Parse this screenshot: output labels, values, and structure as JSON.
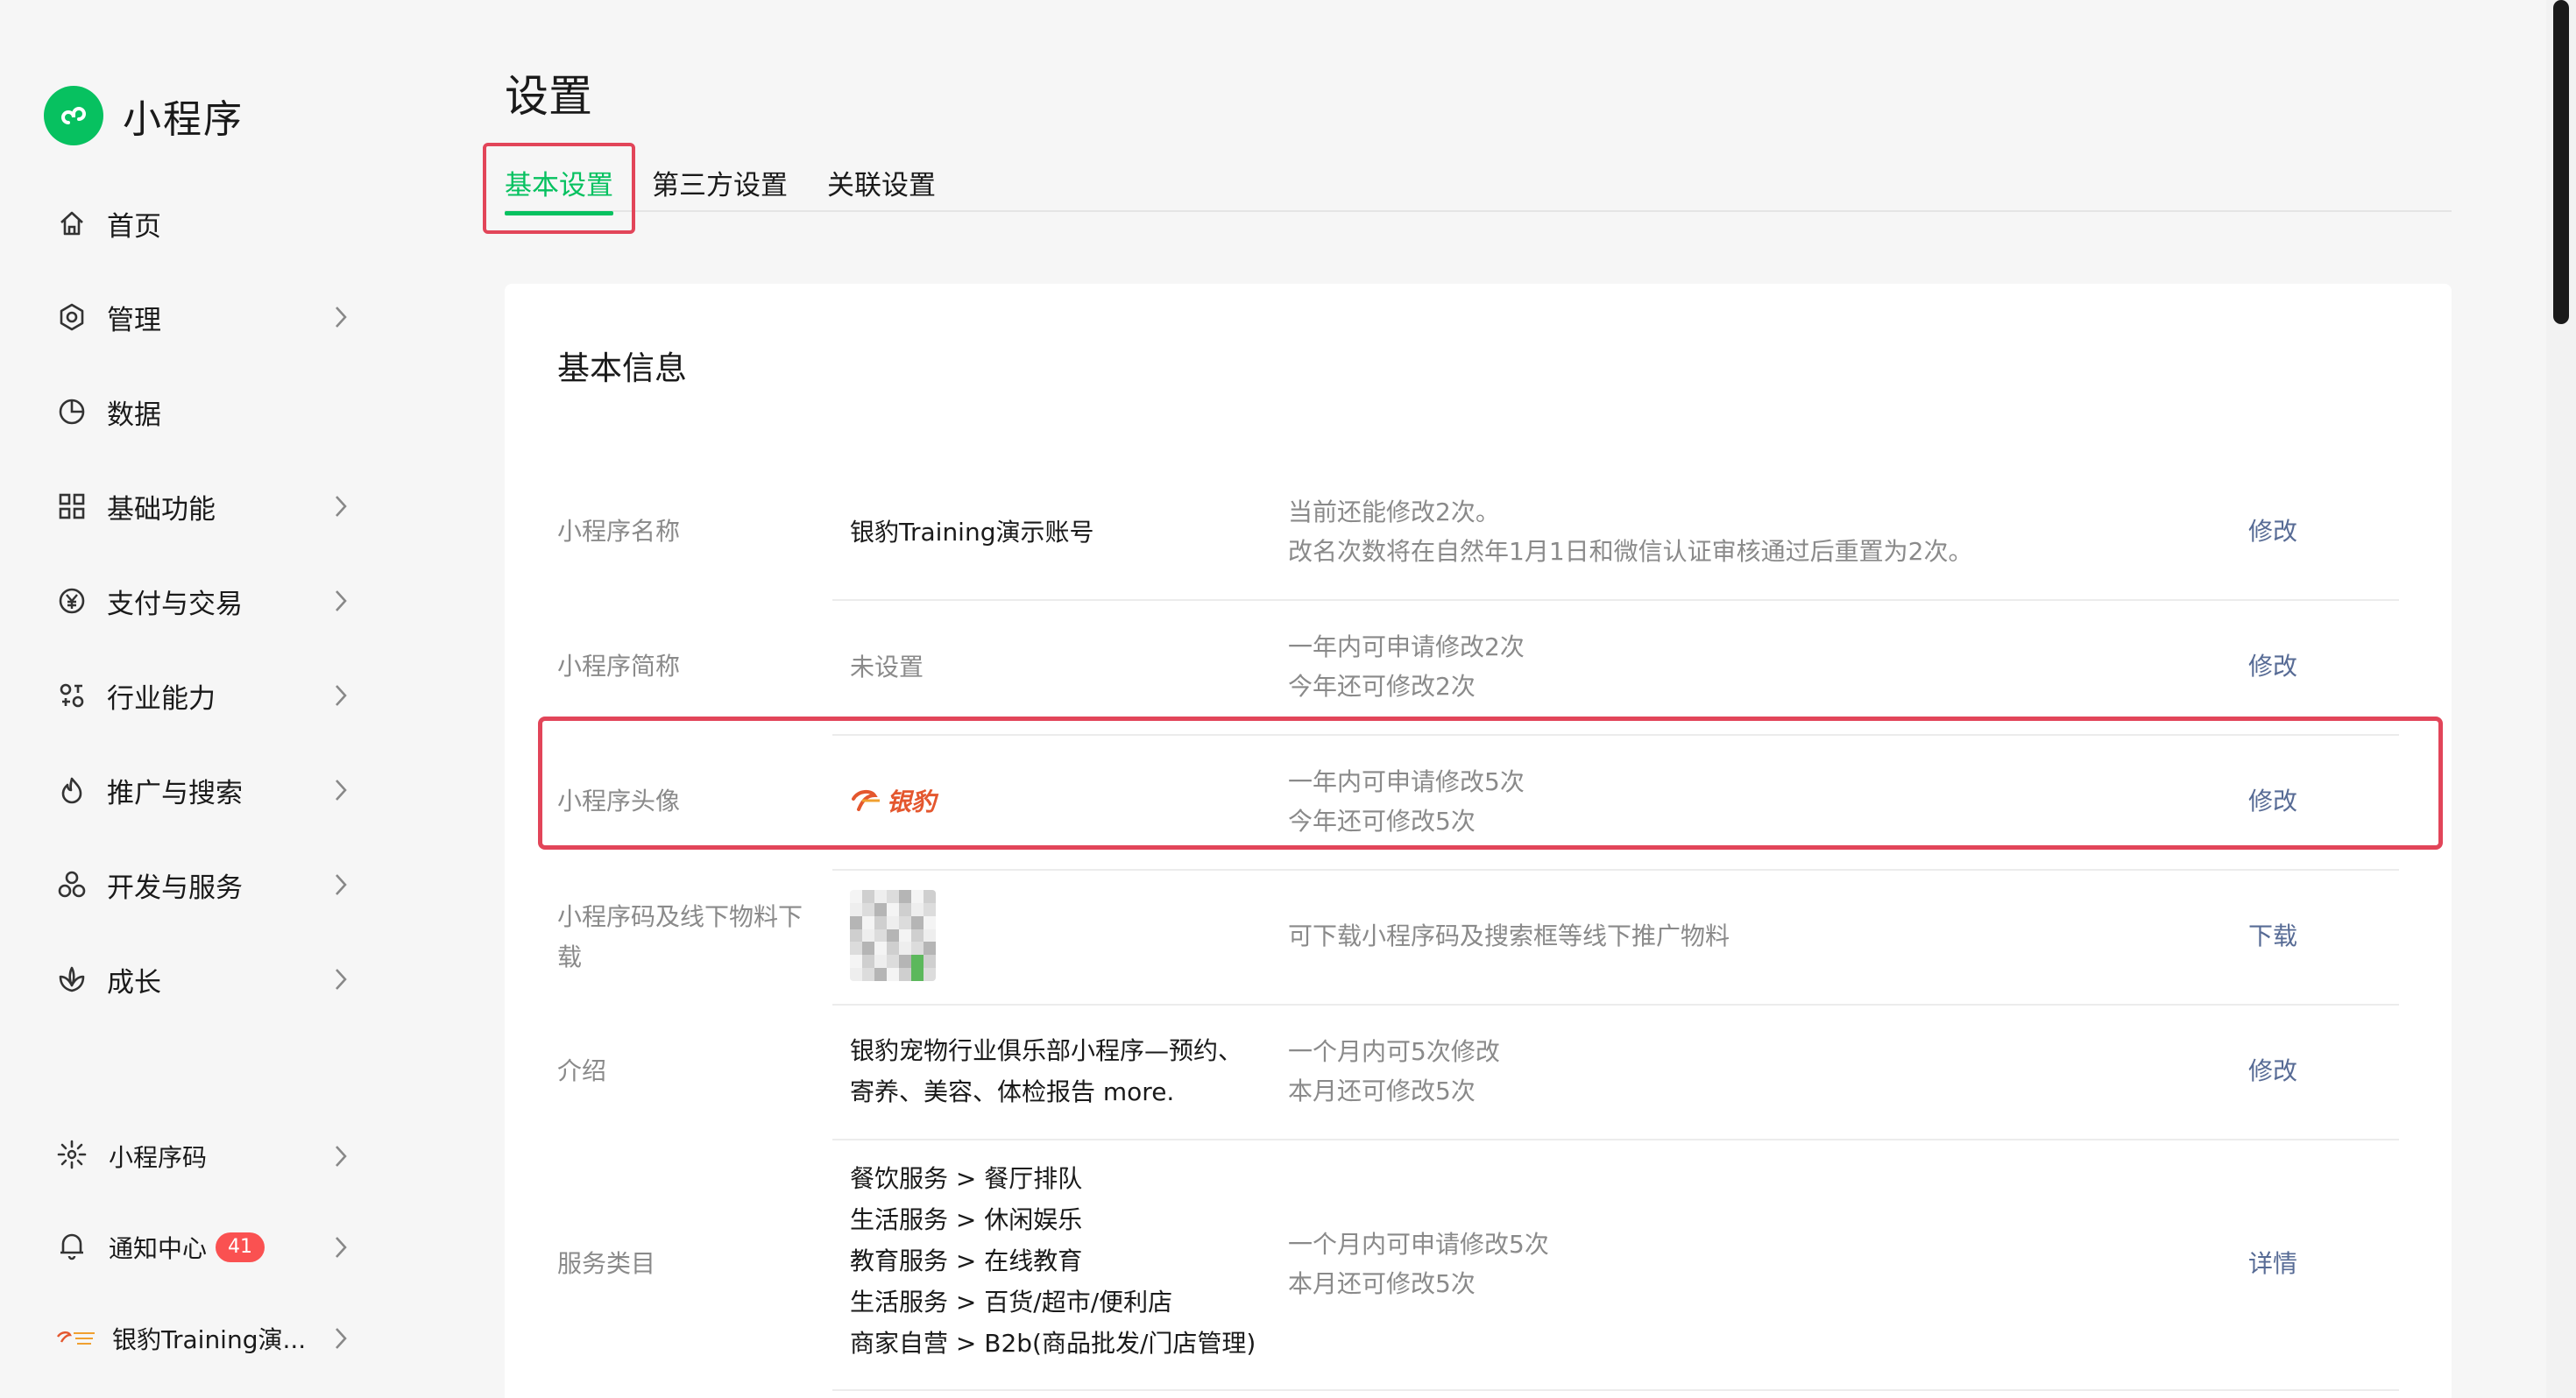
{
  "brand": {
    "name": "小程序",
    "accent": "#07c160"
  },
  "sidebar": {
    "items": [
      {
        "label": "首页",
        "icon": "home-icon",
        "chevron": false
      },
      {
        "label": "管理",
        "icon": "hexagon-settings-icon",
        "chevron": true
      },
      {
        "label": "数据",
        "icon": "pie-chart-icon",
        "chevron": false
      },
      {
        "label": "基础功能",
        "icon": "grid-apps-icon",
        "chevron": true
      },
      {
        "label": "支付与交易",
        "icon": "yen-circle-icon",
        "chevron": true
      },
      {
        "label": "行业能力",
        "icon": "industry-icon",
        "chevron": true
      },
      {
        "label": "推广与搜索",
        "icon": "flame-icon",
        "chevron": true
      },
      {
        "label": "开发与服务",
        "icon": "cluster-icon",
        "chevron": true
      },
      {
        "label": "成长",
        "icon": "lotus-icon",
        "chevron": true
      }
    ],
    "bottom": {
      "qrcode_label": "小程序码",
      "notice_label": "通知中心",
      "notice_count": "41",
      "account_label": "银豹Training演..."
    }
  },
  "page": {
    "title": "设置",
    "tabs": [
      "基本设置",
      "第三方设置",
      "关联设置"
    ],
    "active_tab": 0
  },
  "card": {
    "title": "基本信息",
    "rows": [
      {
        "label": "小程序名称",
        "value": "银豹Training演示账号",
        "desc": [
          "当前还能修改2次。",
          "改名次数将在自然年1月1日和微信认证审核通过后重置为2次。"
        ],
        "action": "修改"
      },
      {
        "label": "小程序简称",
        "value": "未设置",
        "desc": [
          "一年内可申请修改2次",
          "今年还可修改2次"
        ],
        "action": "修改"
      },
      {
        "label": "小程序头像",
        "value_logo_text": "银豹",
        "desc": [
          "一年内可申请修改5次",
          "今年还可修改5次"
        ],
        "action": "修改"
      },
      {
        "label": [
          "小程序码及线下物料下",
          "载"
        ],
        "desc": [
          "可下载小程序码及搜索框等线下推广物料"
        ],
        "action": "下载"
      },
      {
        "label": "介绍",
        "value": [
          "银豹宠物行业俱乐部小程序—预约、",
          "寄养、美容、体检报告 more."
        ],
        "desc": [
          "一个月内可5次修改",
          "本月还可修改5次"
        ],
        "action": "修改"
      },
      {
        "label": "服务类目",
        "value": [
          "餐饮服务 > 餐厅排队",
          "生活服务 > 休闲娱乐",
          "教育服务 > 在线教育",
          "生活服务 > 百货/超市/便利店",
          "商家自营 > B2b(商品批发/门店管理)"
        ],
        "desc": [
          "一个月内可申请修改5次",
          "本月还可修改5次"
        ],
        "action": "详情"
      }
    ]
  },
  "colors": {
    "highlight": "#e24559",
    "link": "#576b95",
    "muted": "#8a8a8a",
    "badge": "#fa5151"
  }
}
